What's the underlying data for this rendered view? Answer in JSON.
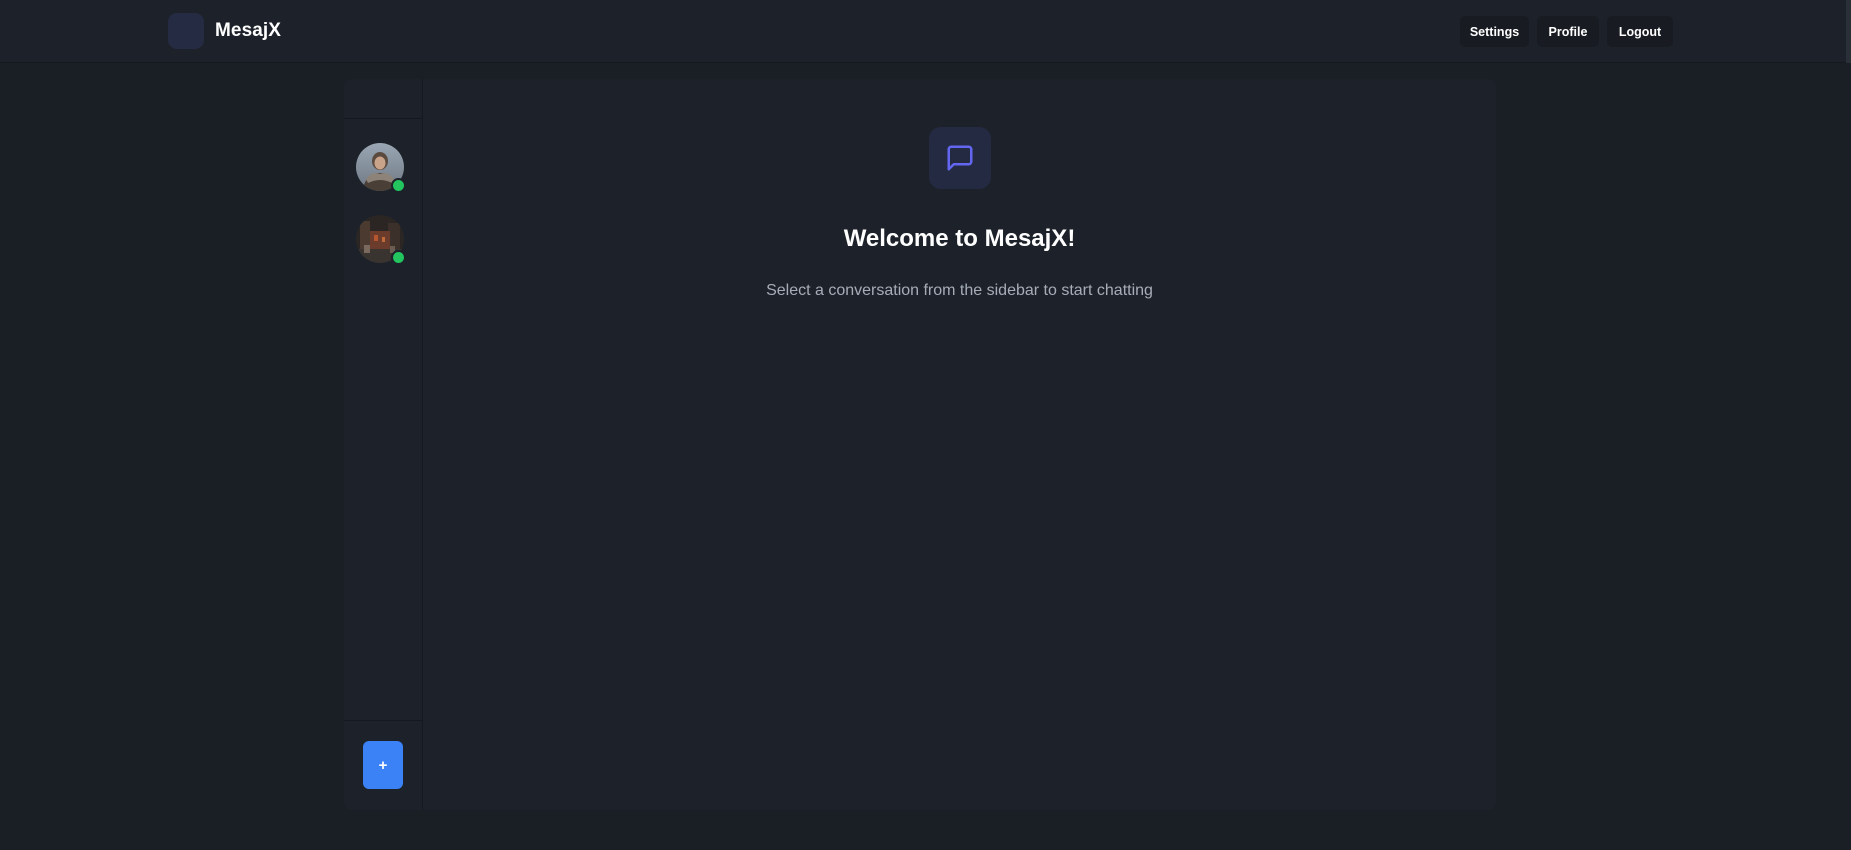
{
  "app": {
    "name": "MesajX"
  },
  "nav": {
    "settings_label": "Settings",
    "profile_label": "Profile",
    "logout_label": "Logout"
  },
  "sidebar": {
    "contacts": [
      {
        "status": "online"
      },
      {
        "status": "online"
      }
    ],
    "add_label": "+"
  },
  "welcome": {
    "icon": "message-square-icon",
    "title": "Welcome to MesajX!",
    "subtitle": "Select a conversation from the sidebar to start chatting"
  },
  "colors": {
    "background": "#1a1e25",
    "surface": "#1d222a",
    "accent": "#3b82f6",
    "icon_accent": "#6366f1",
    "online": "#22c55e"
  }
}
